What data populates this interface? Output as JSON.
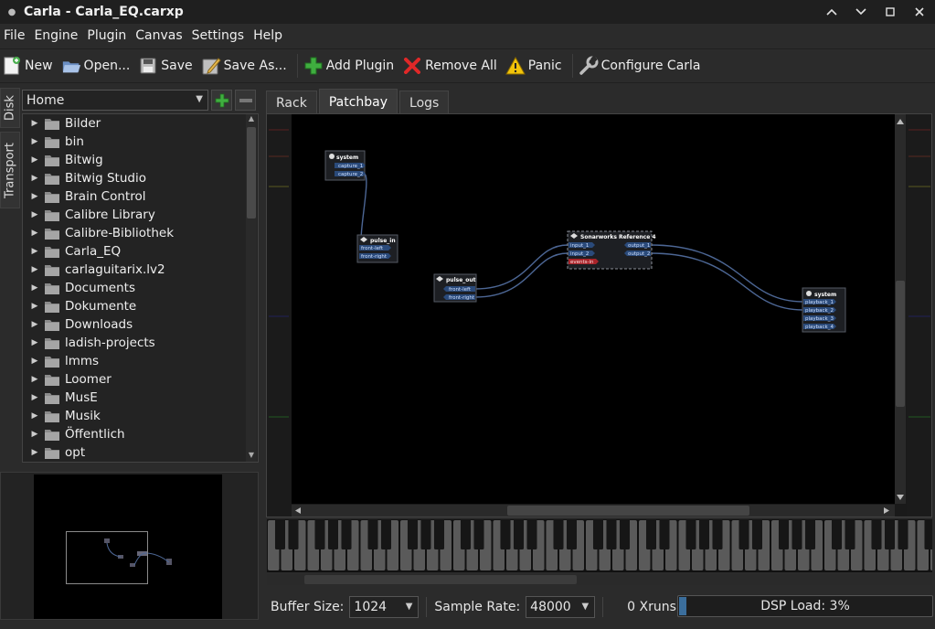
{
  "window": {
    "title": "Carla - Carla_EQ.carxp"
  },
  "menu": [
    "File",
    "Engine",
    "Plugin",
    "Canvas",
    "Settings",
    "Help"
  ],
  "toolbar": {
    "new": "New",
    "open": "Open...",
    "save": "Save",
    "save_as": "Save As...",
    "add_plugin": "Add Plugin",
    "remove_all": "Remove All",
    "panic": "Panic",
    "configure": "Configure Carla"
  },
  "side_tabs": {
    "disk": "Disk",
    "transport": "Transport"
  },
  "browser": {
    "path": "Home",
    "items": [
      "Bilder",
      "bin",
      "Bitwig",
      "Bitwig Studio",
      "Brain Control",
      "Calibre Library",
      "Calibre-Bibliothek",
      "Carla_EQ",
      "carlaguitarix.lv2",
      "Documents",
      "Dokumente",
      "Downloads",
      "ladish-projects",
      "lmms",
      "Loomer",
      "MusE",
      "Musik",
      "Öffentlich",
      "opt"
    ]
  },
  "tabs": [
    "Rack",
    "Patchbay",
    "Logs"
  ],
  "active_tab": 1,
  "patchbay": {
    "system_capture": {
      "title": "system",
      "ports": [
        "capture_1",
        "capture_2"
      ]
    },
    "pulse_in": {
      "title": "pulse_in",
      "ports": [
        "front-left",
        "front-right"
      ]
    },
    "pulse_out": {
      "title": "pulse_out",
      "ports": [
        "front-left",
        "front-right"
      ]
    },
    "sonarworks": {
      "title": "Sonarworks Reference 4",
      "inputs": [
        "input_1",
        "input_2",
        "events-in"
      ],
      "outputs": [
        "output_1",
        "output_2"
      ]
    },
    "system_playback": {
      "title": "system",
      "ports": [
        "playback_1",
        "playback_2",
        "playback_3",
        "playback_4"
      ]
    }
  },
  "status": {
    "buffer_label": "Buffer Size:",
    "buffer_value": "1024",
    "rate_label": "Sample Rate:",
    "rate_value": "48000",
    "xruns": "0 Xruns",
    "dsp_label": "DSP Load: 3%",
    "dsp_load": 0.03
  },
  "colors": {
    "accent": "#3b6e9c",
    "port": "#2a4a7a",
    "event_port": "#a8242a",
    "cable": "#4c6694"
  }
}
